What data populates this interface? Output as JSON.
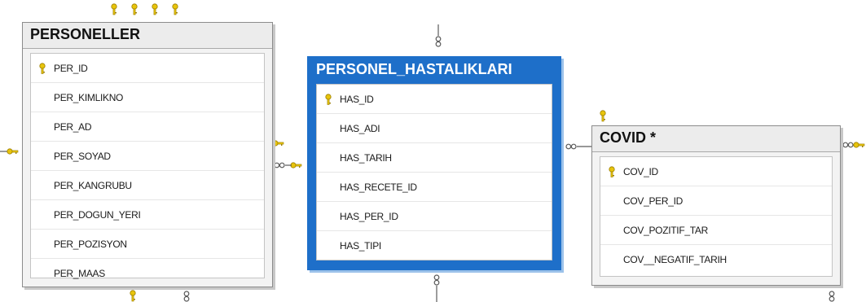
{
  "tables": [
    {
      "name": "PERSONELLER",
      "columns": [
        "PER_ID",
        "PER_KIMLIKNO",
        "PER_AD",
        "PER_SOYAD",
        "PER_KANGRUBU",
        "PER_DOGUN_YERI",
        "PER_POZISYON",
        "PER_MAAS"
      ],
      "primary_key": "PER_ID",
      "selected": false
    },
    {
      "name": "PERSONEL_HASTALIKLARI",
      "columns": [
        "HAS_ID",
        "HAS_ADI",
        "HAS_TARIH",
        "HAS_RECETE_ID",
        "HAS_PER_ID",
        "HAS_TIPI"
      ],
      "primary_key": "HAS_ID",
      "selected": true
    },
    {
      "name": "COVID *",
      "columns": [
        "COV_ID",
        "COV_PER_ID",
        "COV_POZITIF_TAR",
        "COV__NEGATIF_TARIH"
      ],
      "primary_key": "COV_ID",
      "selected": false
    }
  ],
  "colors": {
    "key": "#e8c40c",
    "selection": "#1e6fc9",
    "connector": "#5a5a5a"
  }
}
